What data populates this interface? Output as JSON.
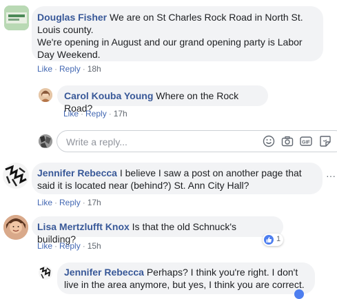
{
  "comments": [
    {
      "author": "Douglas Fisher",
      "text_lines": [
        "We are on St Charles Rock Road in North St.",
        "Louis county.",
        "We're opening in August and our grand opening party is Labor",
        "Day Weekend."
      ],
      "like": "Like",
      "reply": "Reply",
      "time": "18h"
    },
    {
      "author": "Carol Kouba Young",
      "text": "Where on the Rock Road?",
      "like": "Like",
      "reply": "Reply",
      "time": "17h"
    },
    {
      "author": "Jennifer Rebecca",
      "text_lines": [
        "I believe I saw a post on another page that",
        "said it is located near (behind?) St. Ann City Hall?"
      ],
      "like": "Like",
      "reply": "Reply",
      "time": "17h"
    },
    {
      "author": "Lisa Mertzlufft Knox",
      "text": "Is that the old Schnuck's building?",
      "like": "Like",
      "reply": "Reply",
      "time": "15h",
      "reaction_count": "1"
    },
    {
      "author": "Jennifer Rebecca",
      "text_lines": [
        "Perhaps? I think you're right. I don't",
        "live in the area anymore, but yes, I think you are correct."
      ]
    }
  ],
  "reply_box": {
    "placeholder": "Write a reply...",
    "icons": [
      "smiley-icon",
      "camera-icon",
      "gif-icon",
      "sticker-icon"
    ]
  },
  "separator": "·",
  "more_options": "···",
  "colors": {
    "name": "#385898",
    "link": "#4267b2",
    "bubble": "#f2f3f5",
    "meta": "#606770",
    "like_blue": "#4d7eef"
  }
}
